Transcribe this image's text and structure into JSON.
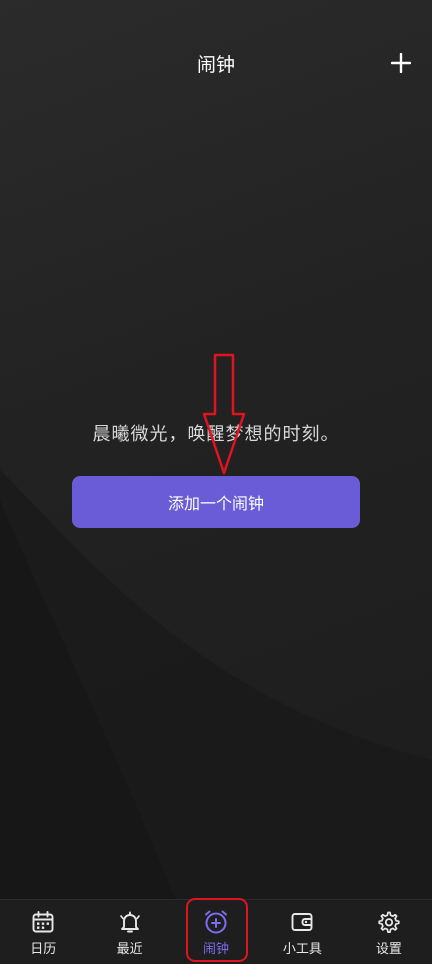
{
  "header": {
    "title": "闹钟",
    "add_icon": "plus-icon"
  },
  "empty_state": {
    "message": "晨曦微光，唤醒梦想的时刻。",
    "button_label": "添加一个闹钟"
  },
  "tabs": [
    {
      "label": "日历",
      "icon": "calendar-icon",
      "active": false
    },
    {
      "label": "最近",
      "icon": "bell-icon",
      "active": false
    },
    {
      "label": "闹钟",
      "icon": "alarm-clock-add-icon",
      "active": true
    },
    {
      "label": "小工具",
      "icon": "wallet-icon",
      "active": false
    },
    {
      "label": "设置",
      "icon": "gear-icon",
      "active": false
    }
  ],
  "colors": {
    "accent": "#6a5cd6",
    "active_tab": "#7b6cf0",
    "annotation": "#e0141e",
    "background": "#222222"
  }
}
